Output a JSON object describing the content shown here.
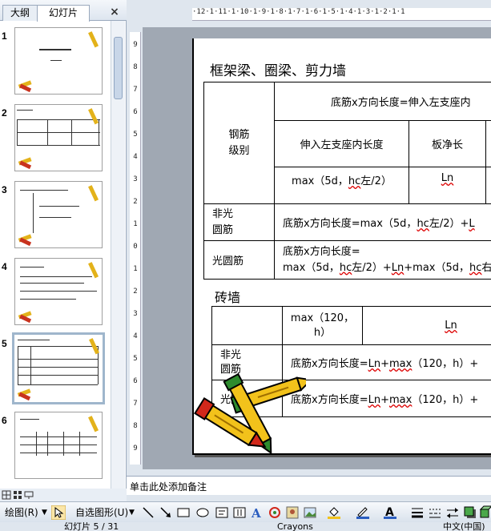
{
  "panel": {
    "tab_outline": "大纲",
    "tab_slides": "幻灯片",
    "close": "×",
    "thumbnails": [
      "1",
      "2",
      "3",
      "4",
      "5",
      "6"
    ],
    "selected": "5"
  },
  "ruler": {
    "h_marks": "·12·1·11·1·10·1·9·1·8·1·7·1·6·1·5·1·4·1·3·1·2·1·1",
    "v_marks": [
      "9",
      "8",
      "7",
      "6",
      "5",
      "4",
      "3",
      "2",
      "1",
      "0",
      "1",
      "2",
      "3",
      "4",
      "5",
      "6",
      "7",
      "8",
      "9"
    ]
  },
  "slide": {
    "title": "框架梁、圈梁、剪力墙",
    "t1": {
      "h_rebar": "钢筋\n级别",
      "h_formula": "底筋x方向长度=伸入左支座内",
      "h_left_len": "伸入左支座内长度",
      "h_clear": "板净长",
      "r_max": "max（5d，",
      "r_hc": "hc",
      "r_max_end": "左/2）",
      "r_ln": "Ln",
      "r_nonround": "非光\n圆筋",
      "r_nonround_formula_a": "底筋x方向长度=max（5d，",
      "r_nonround_formula_b": "hc",
      "r_nonround_formula_c": "左/2）+",
      "r_nonround_formula_d": "L",
      "r_round": "光圆筋",
      "r_round_line1": "底筋x方向长度=",
      "r_round_line2a": "max（5d，",
      "r_round_line2b": "hc",
      "r_round_line2c": "左/2）+",
      "r_round_line2d": "Ln",
      "r_round_line2e": "+max（5d，",
      "r_round_line2f": "hc",
      "r_round_line2g": "右"
    },
    "brick_title": "砖墙",
    "t2": {
      "h_max": "max（120，\nh）",
      "h_ln": "Ln",
      "r_nonround": "非光\n圆筋",
      "r_nonround_a": "底筋x方向长度=",
      "r_nonround_b": "Ln",
      "r_nonround_c": "+",
      "r_nonround_d": "max",
      "r_nonround_e": "（120，h）+",
      "r_round": "光圆筋",
      "r_round_a": "底筋x方向长度=",
      "r_round_b": "Ln",
      "r_round_c": "+",
      "r_round_d": "max",
      "r_round_e": "（120，h）+"
    }
  },
  "notes": {
    "placeholder": "单击此处添加备注"
  },
  "drawbar": {
    "draw": "绘图(R)",
    "autoshapes": "自选图形(U)"
  },
  "status": {
    "slide": "幻灯片 5 / 31",
    "design": "Crayons",
    "lang": "中文(中国)"
  },
  "colors": {
    "accent": "#dfe6ee",
    "selected_border": "#9fb6cc"
  }
}
